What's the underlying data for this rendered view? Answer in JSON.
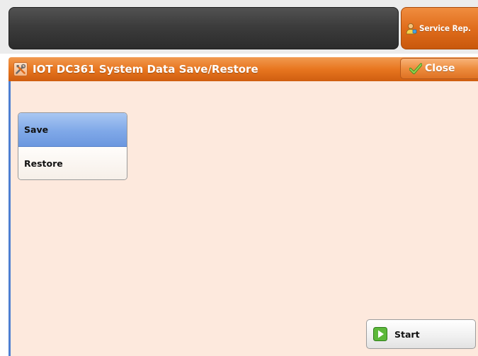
{
  "header": {
    "service_button_label": "Service Rep."
  },
  "titlebar": {
    "title": "IOT DC361 System Data Save/Restore",
    "close_label": "Close"
  },
  "options": [
    {
      "label": "Save",
      "selected": true
    },
    {
      "label": "Restore",
      "selected": false
    }
  ],
  "start_button_label": "Start",
  "icons": {
    "service": "service-rep-icon",
    "tools": "tools-icon",
    "close": "checkmark-icon",
    "start": "start-icon"
  },
  "colors": {
    "accent_orange": "#e8761f",
    "selection_blue": "#7fa8e8",
    "content_bg": "#fde9dd"
  }
}
